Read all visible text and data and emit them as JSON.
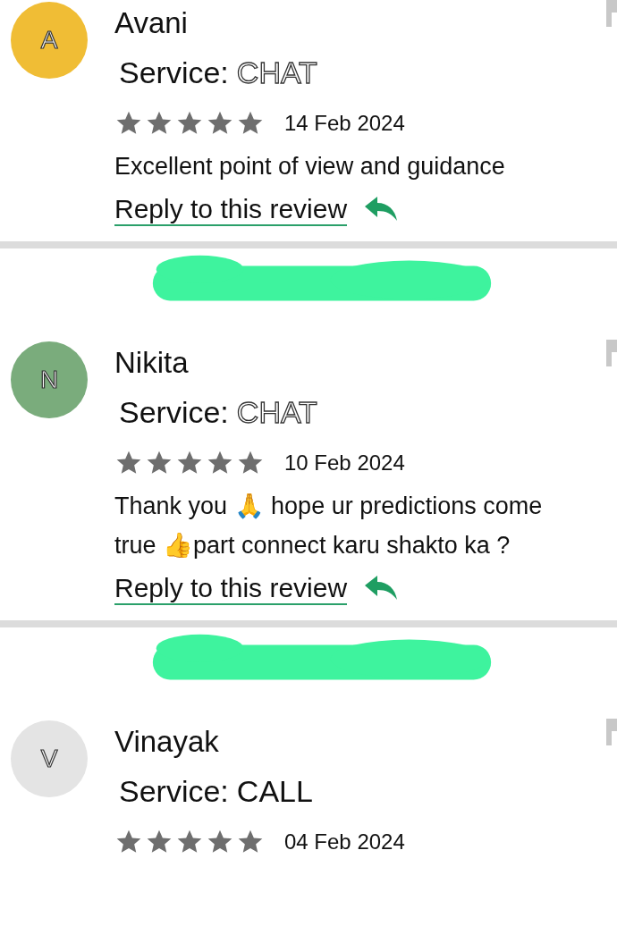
{
  "reviews": [
    {
      "initial": "A",
      "color": "#f0bd35",
      "name": "Avani",
      "service_label": "Service:",
      "service": "CHAT",
      "service_outlined": true,
      "stars": 5,
      "date": "14 Feb 2024",
      "comment": "Excellent point of view and guidance",
      "reply_link": "Reply to this review",
      "redacted_reply": true
    },
    {
      "initial": "N",
      "color": "#7aac7c",
      "name": "Nikita",
      "service_label": "Service:",
      "service": "CHAT",
      "service_outlined": true,
      "stars": 5,
      "date": "10 Feb 2024",
      "comment": "Thank you 🙏 hope ur predictions come true 👍part connect karu shakto ka ?",
      "reply_link": "Reply to this review",
      "redacted_reply": true
    },
    {
      "initial": "V",
      "color": "#e4e4e4",
      "name": "Vinayak",
      "service_label": "Service:",
      "service": "CALL",
      "service_outlined": false,
      "stars": 5,
      "date": "04 Feb 2024"
    }
  ]
}
